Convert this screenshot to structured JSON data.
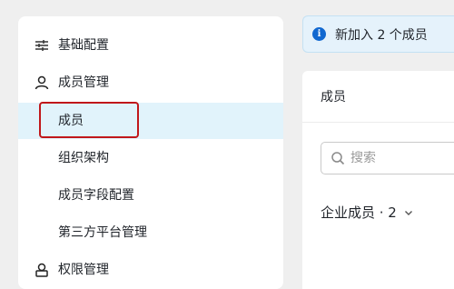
{
  "sidebar": {
    "groups": [
      {
        "label": "基础配置",
        "icon": "sliders-icon"
      },
      {
        "label": "成员管理",
        "icon": "user-icon"
      },
      {
        "label": "权限管理",
        "icon": "lock-icon"
      }
    ],
    "items": [
      {
        "label": "成员",
        "active": true
      },
      {
        "label": "组织架构"
      },
      {
        "label": "成员字段配置"
      },
      {
        "label": "第三方平台管理"
      }
    ]
  },
  "banner": {
    "text": "新加入 2 个成员",
    "icon": "info-icon"
  },
  "main": {
    "header_title": "成员",
    "search": {
      "placeholder": "搜索",
      "value": ""
    },
    "member_count_label": "企业成员 · 2"
  },
  "colors": {
    "accent": "#1168d0",
    "active_bg": "#e1f3fb",
    "highlight_border": "#c0171a",
    "banner_bg": "#e5f2fb"
  }
}
